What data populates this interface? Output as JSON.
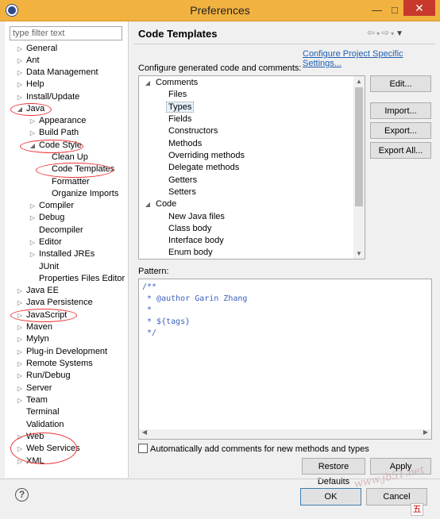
{
  "window": {
    "title": "Preferences",
    "minimize": "—",
    "maximize": "□",
    "close": "✕"
  },
  "filter": {
    "placeholder": "type filter text"
  },
  "tree": {
    "general": "General",
    "ant": "Ant",
    "data_management": "Data Management",
    "help": "Help",
    "install_update": "Install/Update",
    "java": "Java",
    "appearance": "Appearance",
    "build_path": "Build Path",
    "code_style": "Code Style",
    "clean_up": "Clean Up",
    "code_templates": "Code Templates",
    "formatter": "Formatter",
    "organize_imports": "Organize Imports",
    "compiler": "Compiler",
    "debug": "Debug",
    "decompiler": "Decompiler",
    "editor": "Editor",
    "installed_jres": "Installed JREs",
    "junit": "JUnit",
    "properties_files_editor": "Properties Files Editor",
    "java_ee": "Java EE",
    "java_persistence": "Java Persistence",
    "javascript": "JavaScript",
    "maven": "Maven",
    "mylyn": "Mylyn",
    "plugin_development": "Plug-in Development",
    "remote_systems": "Remote Systems",
    "run_debug": "Run/Debug",
    "server": "Server",
    "team": "Team",
    "terminal": "Terminal",
    "validation": "Validation",
    "web": "Web",
    "web_services": "Web Services",
    "xml": "XML"
  },
  "page": {
    "title": "Code Templates",
    "config_link": "Configure Project Specific Settings...",
    "config_label": "Configure generated code and comments:"
  },
  "templates": {
    "comments": "Comments",
    "files": "Files",
    "types": "Types",
    "fields": "Fields",
    "constructors": "Constructors",
    "methods": "Methods",
    "overriding_methods": "Overriding methods",
    "delegate_methods": "Delegate methods",
    "getters": "Getters",
    "setters": "Setters",
    "code": "Code",
    "new_java_files": "New Java files",
    "class_body": "Class body",
    "interface_body": "Interface body",
    "enum_body": "Enum body"
  },
  "buttons": {
    "edit": "Edit...",
    "import": "Import...",
    "export": "Export...",
    "export_all": "Export All...",
    "restore_defaults": "Restore Defaults",
    "apply": "Apply",
    "ok": "OK",
    "cancel": "Cancel"
  },
  "pattern": {
    "label": "Pattern:",
    "content": "/**\n * @author Garin Zhang\n *\n * ${tags}\n */"
  },
  "auto_comments": {
    "label": "Automatically add comments for new methods and types",
    "checked": false
  },
  "watermark": "www.jb51.net",
  "ime": "五",
  "colors": {
    "titlebar": "#f2b240",
    "link": "#1f5fb3",
    "annotation_circle": "#ee3333",
    "javadoc": "#3f5fbf"
  }
}
